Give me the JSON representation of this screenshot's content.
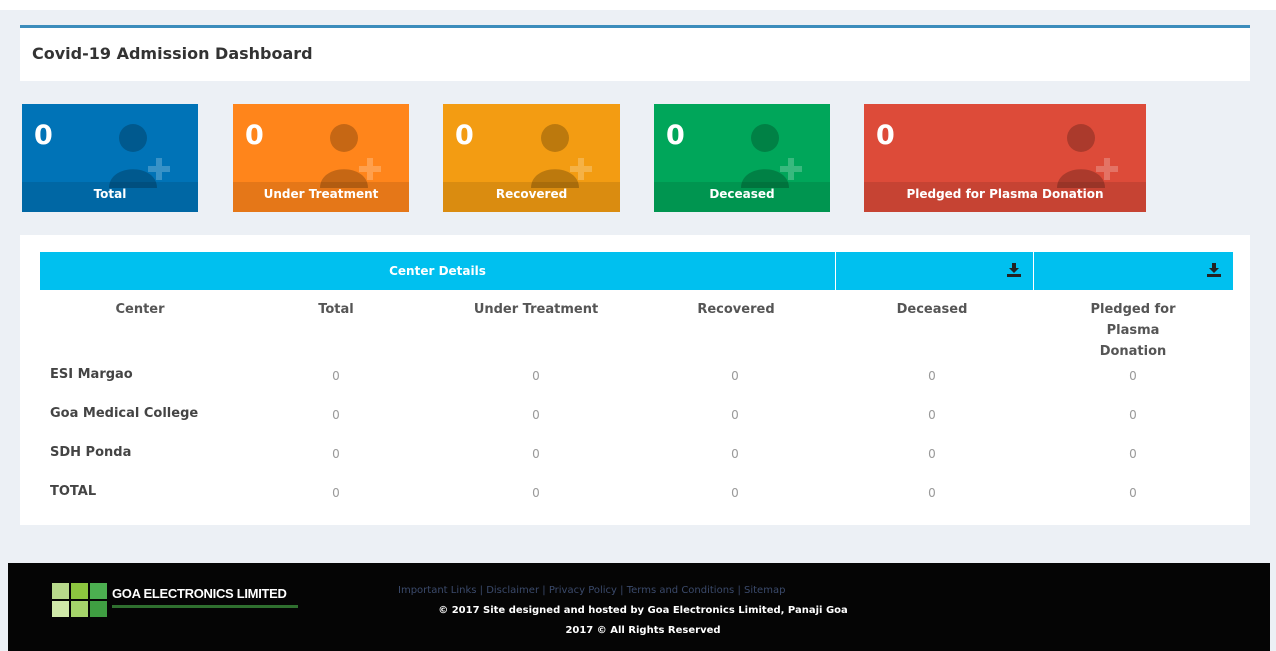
{
  "page": {
    "title": "Covid-19 Admission Dashboard"
  },
  "cards": [
    {
      "value": "0",
      "label": "Total",
      "color": "#0073b7"
    },
    {
      "value": "0",
      "label": "Under Treatment",
      "color": "#ff851b"
    },
    {
      "value": "0",
      "label": "Recovered",
      "color": "#f39c12"
    },
    {
      "value": "0",
      "label": "Deceased",
      "color": "#00a65a"
    },
    {
      "value": "0",
      "label": "Pledged for Plasma Donation",
      "color": "#dd4b39"
    }
  ],
  "table": {
    "header_title": "Center Details",
    "download_icons": [
      "download-icon",
      "download-icon"
    ],
    "columns": [
      "Center",
      "Total",
      "Under Treatment",
      "Recovered",
      "Deceased",
      "Pledged for Plasma Donation"
    ],
    "rows": [
      {
        "center": "ESI Margao",
        "values": [
          "0",
          "0",
          "0",
          "0",
          "0"
        ]
      },
      {
        "center": "Goa Medical College",
        "values": [
          "0",
          "0",
          "0",
          "0",
          "0"
        ]
      },
      {
        "center": "SDH Ponda",
        "values": [
          "0",
          "0",
          "0",
          "0",
          "0"
        ]
      },
      {
        "center": "TOTAL",
        "values": [
          "0",
          "0",
          "0",
          "0",
          "0"
        ]
      }
    ]
  },
  "footer": {
    "logo_text": "GOA ELECTRONICS LIMITED",
    "links": [
      "Important Links",
      "Disclaimer",
      "Privacy Policy",
      "Terms and Conditions",
      "Sitemap"
    ],
    "copyright_line1": "© 2017 Site designed and hosted by Goa Electronics Limited, Panaji Goa",
    "copyright_line2": "2017 © All Rights Reserved"
  },
  "colors": {
    "accent": "#3c8dbc",
    "table_header": "#00c0ef",
    "footer_bg": "#050505"
  }
}
